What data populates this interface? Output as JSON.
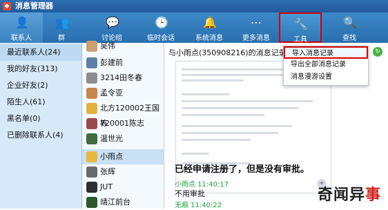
{
  "window": {
    "title": "消息管理器"
  },
  "toolbar": {
    "items": [
      {
        "label": "联系人",
        "icon": "contacts-icon"
      },
      {
        "label": "群",
        "icon": "group-icon"
      },
      {
        "label": "讨论组",
        "icon": "discussion-icon"
      },
      {
        "label": "临时会话",
        "icon": "temp-chat-icon"
      },
      {
        "label": "系统消息",
        "icon": "system-message-icon"
      },
      {
        "label": "更多消息",
        "icon": "more-icon"
      },
      {
        "label": "工具",
        "icon": "tools-icon"
      },
      {
        "label": "查找",
        "icon": "search-icon"
      }
    ]
  },
  "leftnav": {
    "items": [
      "最近联系人(24)",
      "我的好友(313)",
      "企业好友(2)",
      "陌生人(61)",
      "黑名单(0)",
      "已删除联系人(4)"
    ]
  },
  "contacts": {
    "items": [
      "吴伟",
      "彭建前",
      "3214田冬春",
      "孟令亚",
      "北方120002王国栋",
      "720001陈志",
      "温世光",
      "小雨点",
      "张辉",
      "JUT",
      "靖江前台"
    ]
  },
  "history": {
    "title": "与小雨点(350908216)的消息记录",
    "big_message": "已经申请注册了，但是没有审批。",
    "sender1": "小雨点 11:40:17",
    "line2": "不用审批",
    "sender2": "无痕 11:40:22"
  },
  "dropdown": {
    "items": [
      "导入消息记录",
      "导出全部消息记录",
      "消息漫游设置"
    ]
  },
  "watermark": {
    "text1": "奇闻异",
    "text2": "事"
  },
  "colors": {
    "accent": "#286fae",
    "highlight": "#d40000",
    "time_green": "#1a9f3c"
  }
}
